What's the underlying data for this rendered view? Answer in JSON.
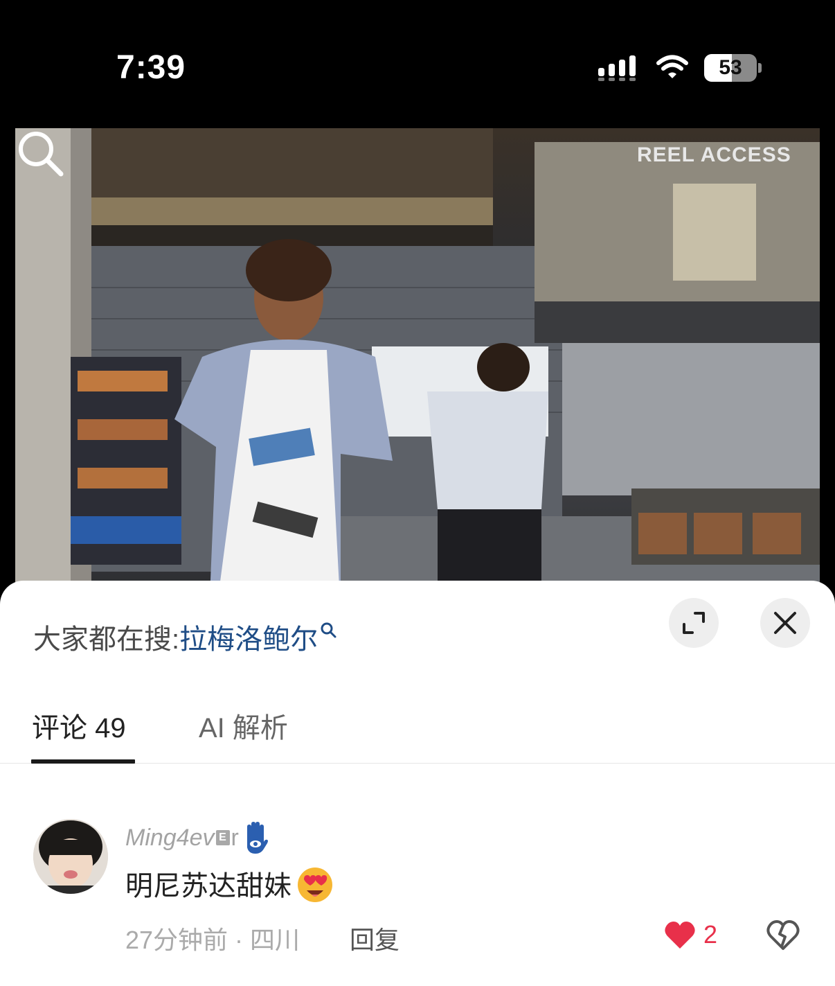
{
  "status_bar": {
    "time": "7:39",
    "battery_text": "53",
    "battery_level": 0.53,
    "icons": [
      "signal-icon",
      "wifi-icon",
      "battery-icon"
    ]
  },
  "video": {
    "watermark": "REEL ACCESS",
    "icons": [
      "search-icon"
    ]
  },
  "sheet": {
    "search_hint_prefix": "大家都在搜:",
    "search_hint_keyword": "拉梅洛鲍尔",
    "icons": [
      "search-icon",
      "expand-icon",
      "close-icon"
    ]
  },
  "tabs": [
    {
      "label": "评论 49",
      "active": true
    },
    {
      "label": "AI 解析",
      "active": false
    }
  ],
  "comments": [
    {
      "username": "Ming4ev",
      "username_badge": "E",
      "username_suffix": "r",
      "text": "明尼苏达甜妹",
      "meta": "27分钟前 · 四川",
      "reply_label": "回复",
      "like_count": "2",
      "liked": true,
      "colors": {
        "like": "#e8304a",
        "keyword": "#1f4d86"
      }
    }
  ]
}
